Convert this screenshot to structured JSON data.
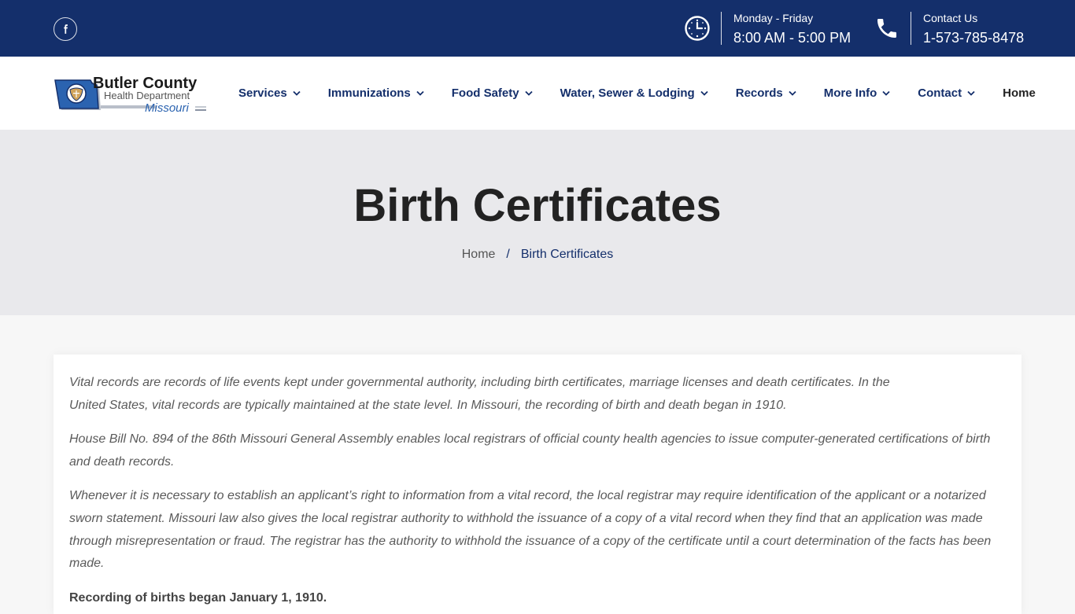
{
  "topbar": {
    "social": {
      "icon": "facebook-icon"
    },
    "hours": {
      "icon": "clock-icon",
      "label": "Monday - Friday",
      "value": "8:00 AM - 5:00 PM"
    },
    "contact": {
      "icon": "phone-icon",
      "label": "Contact Us",
      "value": "1-573-785-8478"
    }
  },
  "logo": {
    "line1": "Butler County",
    "line2": "Health Department",
    "line3": "Missouri"
  },
  "nav": {
    "items": [
      {
        "label": "Services",
        "dropdown": true
      },
      {
        "label": "Immunizations",
        "dropdown": true
      },
      {
        "label": "Food Safety",
        "dropdown": true
      },
      {
        "label": "Water, Sewer & Lodging",
        "dropdown": true
      },
      {
        "label": "Records",
        "dropdown": true
      },
      {
        "label": "More Info",
        "dropdown": true
      },
      {
        "label": "Contact",
        "dropdown": true
      },
      {
        "label": "Home",
        "dropdown": false
      }
    ]
  },
  "hero": {
    "title": "Birth Certificates",
    "breadcrumb": {
      "home": "Home",
      "separator": "/",
      "current": "Birth Certificates"
    }
  },
  "content": {
    "paragraphs": [
      "Vital records are records of life events kept under governmental authority, including birth certificates, marriage licenses and death certificates. In the United States, vital records are typically maintained at the state level. In Missouri, the recording of birth and death began in 1910.",
      "House Bill No. 894 of the 86th Missouri General Assembly enables local registrars of official county health agencies to issue computer-generated certifications of birth and death records.",
      "Whenever it is necessary to establish an applicant’s right to information from a vital record, the local registrar may require identification of the applicant or a notarized sworn statement. Missouri law also gives the local registrar authority to withhold the issuance of a copy of a vital record when they find that an application was made through misrepresentation or fraud. The registrar has the authority to withhold the issuance of a copy of the certificate until a court determination of the facts has been made."
    ],
    "strong": "Recording of births began January 1, 1910."
  },
  "colors": {
    "brand_navy": "#142f6b",
    "hero_bg": "#e9e9ec",
    "page_bg": "#f7f7f7"
  }
}
